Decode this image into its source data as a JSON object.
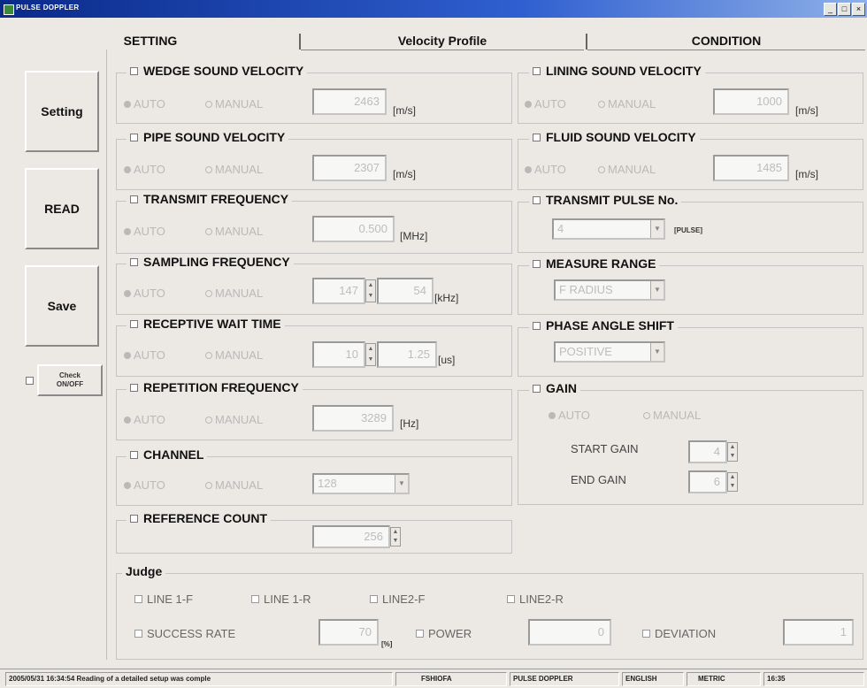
{
  "window": {
    "title": "PULSE DOPPLER",
    "minimize": "_",
    "restore": "□",
    "close": "×"
  },
  "tabs": [
    {
      "label": "SETTING"
    },
    {
      "label": "Velocity Profile"
    },
    {
      "label": "CONDITION"
    }
  ],
  "sidebar": {
    "setting": "Setting",
    "read": "READ",
    "save": "Save",
    "check_line1": "Check",
    "check_line2": "ON/OFF"
  },
  "common": {
    "auto": "AUTO",
    "manual": "MANUAL"
  },
  "groups": {
    "wedge": {
      "title": "WEDGE SOUND VELOCITY",
      "value": "2463",
      "unit": "[m/s]"
    },
    "pipe": {
      "title": "PIPE SOUND VELOCITY",
      "value": "2307",
      "unit": "[m/s]"
    },
    "transmit_freq": {
      "title": "TRANSMIT FREQUENCY",
      "value": "0.500",
      "unit": "[MHz]"
    },
    "sampling_freq": {
      "title": "SAMPLING FREQUENCY",
      "value1": "147",
      "value2": "54",
      "unit": "[kHz]"
    },
    "receptive_wait": {
      "title": "RECEPTIVE WAIT TIME",
      "value1": "10",
      "value2": "1.25",
      "unit": "[us]"
    },
    "repetition_freq": {
      "title": "REPETITION FREQUENCY",
      "value": "3289",
      "unit": "[Hz]"
    },
    "channel": {
      "title": "CHANNEL",
      "value": "128"
    },
    "reference_count": {
      "title": "REFERENCE COUNT",
      "value": "256"
    },
    "lining": {
      "title": "LINING SOUND VELOCITY",
      "value": "1000",
      "unit": "[m/s]"
    },
    "fluid": {
      "title": "FLUID SOUND VELOCITY",
      "value": "1485",
      "unit": "[m/s]"
    },
    "transmit_pulse": {
      "title": "TRANSMIT PULSE No.",
      "value": "4",
      "unit": "[PULSE]"
    },
    "measure_range": {
      "title": "MEASURE RANGE",
      "value": "F RADIUS"
    },
    "phase_angle": {
      "title": "PHASE ANGLE SHIFT",
      "value": "POSITIVE"
    },
    "gain": {
      "title": "GAIN",
      "start_label": "START GAIN",
      "start_value": "4",
      "end_label": "END GAIN",
      "end_value": "6"
    }
  },
  "judge": {
    "title": "Judge",
    "line1f": "LINE 1-F",
    "line1r": "LINE 1-R",
    "line2f": "LINE2-F",
    "line2r": "LINE2-R",
    "success_rate": "SUCCESS RATE",
    "success_value": "70",
    "success_unit": "[%]",
    "power": "POWER",
    "power_value": "0",
    "deviation": "DEVIATION",
    "deviation_value": "1"
  },
  "status": {
    "message": "2005/05/31 16:34:54 Reading of a detailed setup was comple",
    "machine": "FSHIOFA",
    "mode": "PULSE DOPPLER",
    "language": "ENGLISH",
    "units": "METRIC",
    "time": "16:35"
  }
}
